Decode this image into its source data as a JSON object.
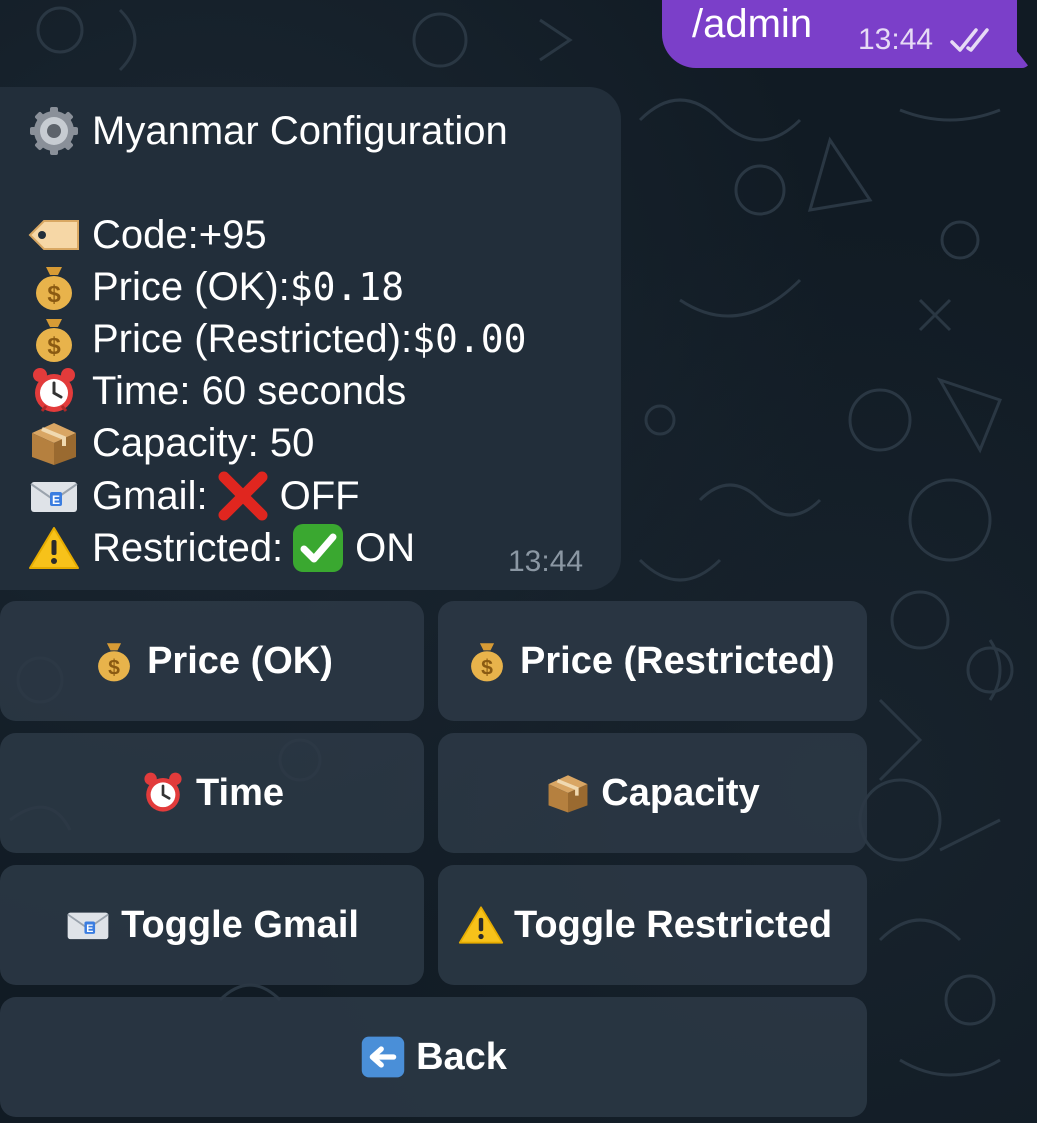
{
  "outgoing": {
    "text": "/admin",
    "time": "13:44",
    "status_icon": "double-check-icon"
  },
  "message": {
    "title": "Myanmar Configuration",
    "title_icon": "gear-icon",
    "lines": [
      {
        "icon": "tag-icon",
        "label": "Code: ",
        "value": "+95"
      },
      {
        "icon": "money-bag-icon",
        "label": "Price (OK): ",
        "value": "$0.18"
      },
      {
        "icon": "money-bag-icon",
        "label": "Price (Restricted): ",
        "value": "$0.00"
      },
      {
        "icon": "alarm-clock-icon",
        "label": "Time: 60 seconds"
      },
      {
        "icon": "package-icon",
        "label": "Capacity: 50"
      },
      {
        "icon": "envelope-icon",
        "label": "Gmail: ",
        "status_icon": "cross-mark-icon",
        "status": "OFF"
      },
      {
        "icon": "warning-icon",
        "label": "Restricted: ",
        "status_icon": "check-mark-icon",
        "status": "ON"
      }
    ],
    "time": "13:44"
  },
  "keyboard": {
    "price_ok": "Price (OK)",
    "price_restricted": "Price (Restricted)",
    "time": "Time",
    "capacity": "Capacity",
    "toggle_gmail": "Toggle Gmail",
    "toggle_restricted": "Toggle Restricted",
    "back": "Back"
  },
  "colors": {
    "outgoing_bubble": "#7b3fc9",
    "incoming_bubble": "#222e3a",
    "button": "#2c3946",
    "background": "#111b24"
  }
}
